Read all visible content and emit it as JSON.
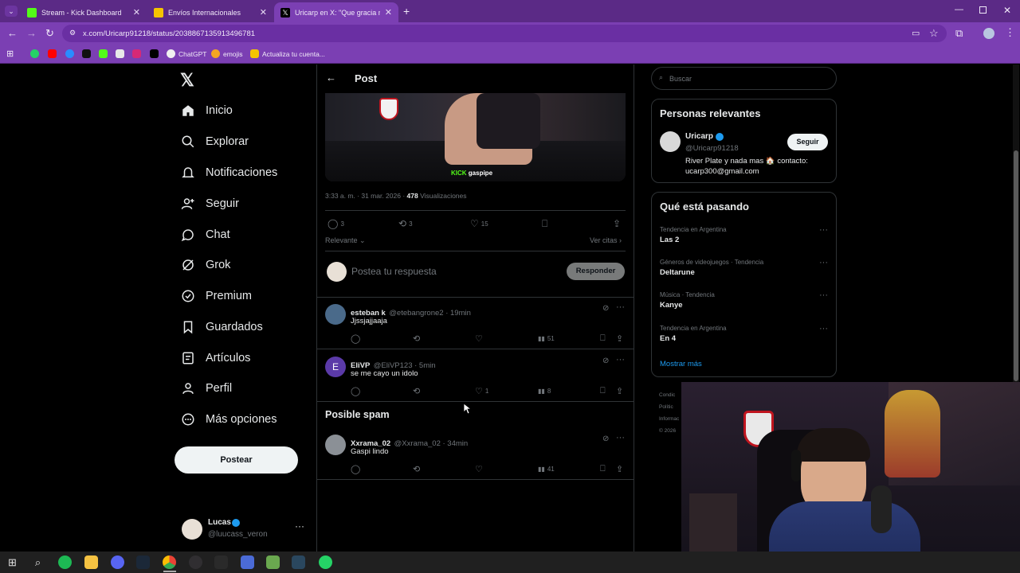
{
  "browser": {
    "tabs": [
      {
        "label": "Stream - Kick Dashboard",
        "color": "#53fc18"
      },
      {
        "label": "Envíos Internacionales",
        "color": "#f5c400"
      },
      {
        "label": "Uricarp en X: \"Que gracia me d",
        "color": "#000000"
      }
    ],
    "url": "x.com/Uricarp91218/status/2038867135913496781",
    "bookmarks": [
      {
        "label": "ChatGPT"
      },
      {
        "label": "emojis"
      },
      {
        "label": "Actualiza tu cuenta..."
      }
    ]
  },
  "sidebar": {
    "items": [
      {
        "label": "Inicio",
        "icon": "home-icon"
      },
      {
        "label": "Explorar",
        "icon": "search-icon"
      },
      {
        "label": "Notificaciones",
        "icon": "bell-icon"
      },
      {
        "label": "Seguir",
        "icon": "person-plus-icon"
      },
      {
        "label": "Chat",
        "icon": "chat-icon"
      },
      {
        "label": "Grok",
        "icon": "grok-icon"
      },
      {
        "label": "Premium",
        "icon": "verified-icon"
      },
      {
        "label": "Guardados",
        "icon": "bookmark-icon"
      },
      {
        "label": "Artículos",
        "icon": "article-icon"
      },
      {
        "label": "Perfil",
        "icon": "person-icon"
      },
      {
        "label": "Más opciones",
        "icon": "more-circle-icon"
      }
    ],
    "post_button": "Postear",
    "account": {
      "name": "Lucas",
      "handle": "@luucass_veron"
    }
  },
  "post": {
    "header": "Post",
    "video_overlay": "gaspipe",
    "meta_time": "3:33 a. m. · 31 mar. 2026 · ",
    "meta_views": "478",
    "meta_views_label": " Visualizaciones",
    "stats": {
      "replies": "3",
      "reposts": "3",
      "likes": "15"
    },
    "sort_label": "Relevante",
    "quotes_label": "Ver citas",
    "reply_placeholder": "Postea tu respuesta",
    "reply_button": "Responder"
  },
  "replies": [
    {
      "name": "esteban k",
      "handle": "@etebangrone2 · 19min",
      "text": "Jjssjajjaaja",
      "likes": "",
      "views": "51",
      "avatar_color": "#4a6a8a"
    },
    {
      "name": "EliVP",
      "handle": "@EliVP123 · 5min",
      "text": "se me cayo un idolo",
      "likes": "1",
      "views": "8",
      "avatar_color": "#5b3aa8",
      "avatar_letter": "E"
    }
  ],
  "spam": {
    "title": "Posible spam",
    "reply": {
      "name": "Xxrama_02",
      "handle": "@Xxrama_02 · 34min",
      "text": "Gaspi lindo",
      "views": "41"
    }
  },
  "right": {
    "search_placeholder": "Buscar",
    "relevant": {
      "title": "Personas relevantes",
      "name": "Uricarp",
      "handle": "@Uricarp91218",
      "follow": "Seguir",
      "bio": "River Plate y nada mas 🏠 contacto: ucarp300@gmail.com"
    },
    "trending": {
      "title": "Qué está pasando",
      "items": [
        {
          "category": "Tendencia en Argentina",
          "name": "Las 2"
        },
        {
          "category": "Géneros de videojuegos · Tendencia",
          "name": "Deltarune"
        },
        {
          "category": "Música · Tendencia",
          "name": "Kanye"
        },
        {
          "category": "Tendencia en Argentina",
          "name": "En 4"
        }
      ],
      "more": "Mostrar más"
    },
    "footer_partial": [
      "Condic",
      "Polític",
      "Informac",
      "© 2026"
    ]
  }
}
